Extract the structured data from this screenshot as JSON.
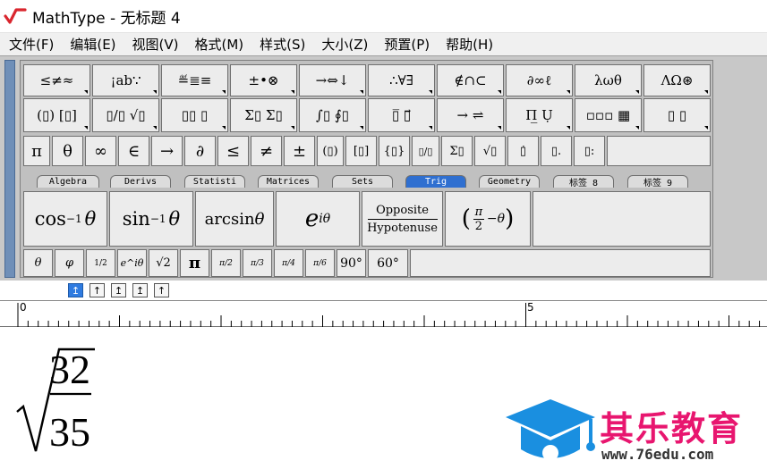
{
  "window": {
    "title": "MathType - 无标题 4"
  },
  "menu": {
    "items": [
      {
        "label": "文件(F)"
      },
      {
        "label": "编辑(E)"
      },
      {
        "label": "视图(V)"
      },
      {
        "label": "格式(M)"
      },
      {
        "label": "样式(S)"
      },
      {
        "label": "大小(Z)"
      },
      {
        "label": "预置(P)"
      },
      {
        "label": "帮助(H)"
      }
    ]
  },
  "palette_row1": {
    "labels": [
      "≤≠≈",
      "¡ab∵",
      "≝≣≡",
      "±•⊗",
      "→⇔↓",
      "∴∀∃",
      "∉∩⊂",
      "∂∞ℓ",
      "λωθ",
      "ΛΩ⊛"
    ]
  },
  "palette_row2": {
    "labels": [
      "(▯) [▯]",
      "▯/▯ √▯",
      "▯▯ ▯",
      "Σ▯ Σ▯",
      "∫▯ ∮▯",
      "▯̅ ▯⃗",
      "→ ⇌",
      "Π̲ Ụ",
      "▫▫▫ ▦",
      "▯ ▯"
    ]
  },
  "symbols_row": {
    "labels": [
      "π",
      "θ",
      "∞",
      "∈",
      "→",
      "∂",
      "≤",
      "≠",
      "±",
      "(▯)",
      "[▯]",
      "{▯}",
      "▯/▯",
      "Σ▯",
      "√▯",
      "▯̇",
      "▯.",
      "▯:"
    ]
  },
  "tabs": {
    "labels": [
      "Algebra",
      "Derivs",
      "Statisti",
      "Matrices",
      "Sets",
      "Trig",
      "Geometry",
      "标签 8",
      "标签 9"
    ],
    "active": "Trig"
  },
  "trig_templates": {
    "cos_inverse": {
      "fn": "cos",
      "sup": "−1",
      "var": "θ"
    },
    "sin_inverse": {
      "fn": "sin",
      "sup": "−1",
      "var": "θ"
    },
    "arcsin": {
      "fn": "arcsin",
      "var": "θ"
    },
    "exp": {
      "base": "e",
      "sup": "iθ"
    },
    "ratio": {
      "numerator": "Opposite",
      "denominator": "Hypotenuse"
    },
    "shift": {
      "num": "π",
      "den": "2",
      "rest": "−θ"
    }
  },
  "small_templates": {
    "labels": [
      "θ",
      "φ",
      "1/2",
      "e^iθ",
      "√2",
      "π",
      "π/2",
      "π/3",
      "π/4",
      "π/6",
      "90°",
      "60°"
    ]
  },
  "nudge": {
    "labels": [
      "↥",
      "↑",
      "↥",
      "↥",
      "↑"
    ]
  },
  "ruler": {
    "start_label": "0",
    "mid_label": "5"
  },
  "equation": {
    "numerator": "32",
    "denominator": "35"
  },
  "watermark": {
    "brand": "其乐教育",
    "url": "www.76edu.com",
    "brand_color": "#e8166f",
    "logo_color": "#1a8fe0"
  }
}
